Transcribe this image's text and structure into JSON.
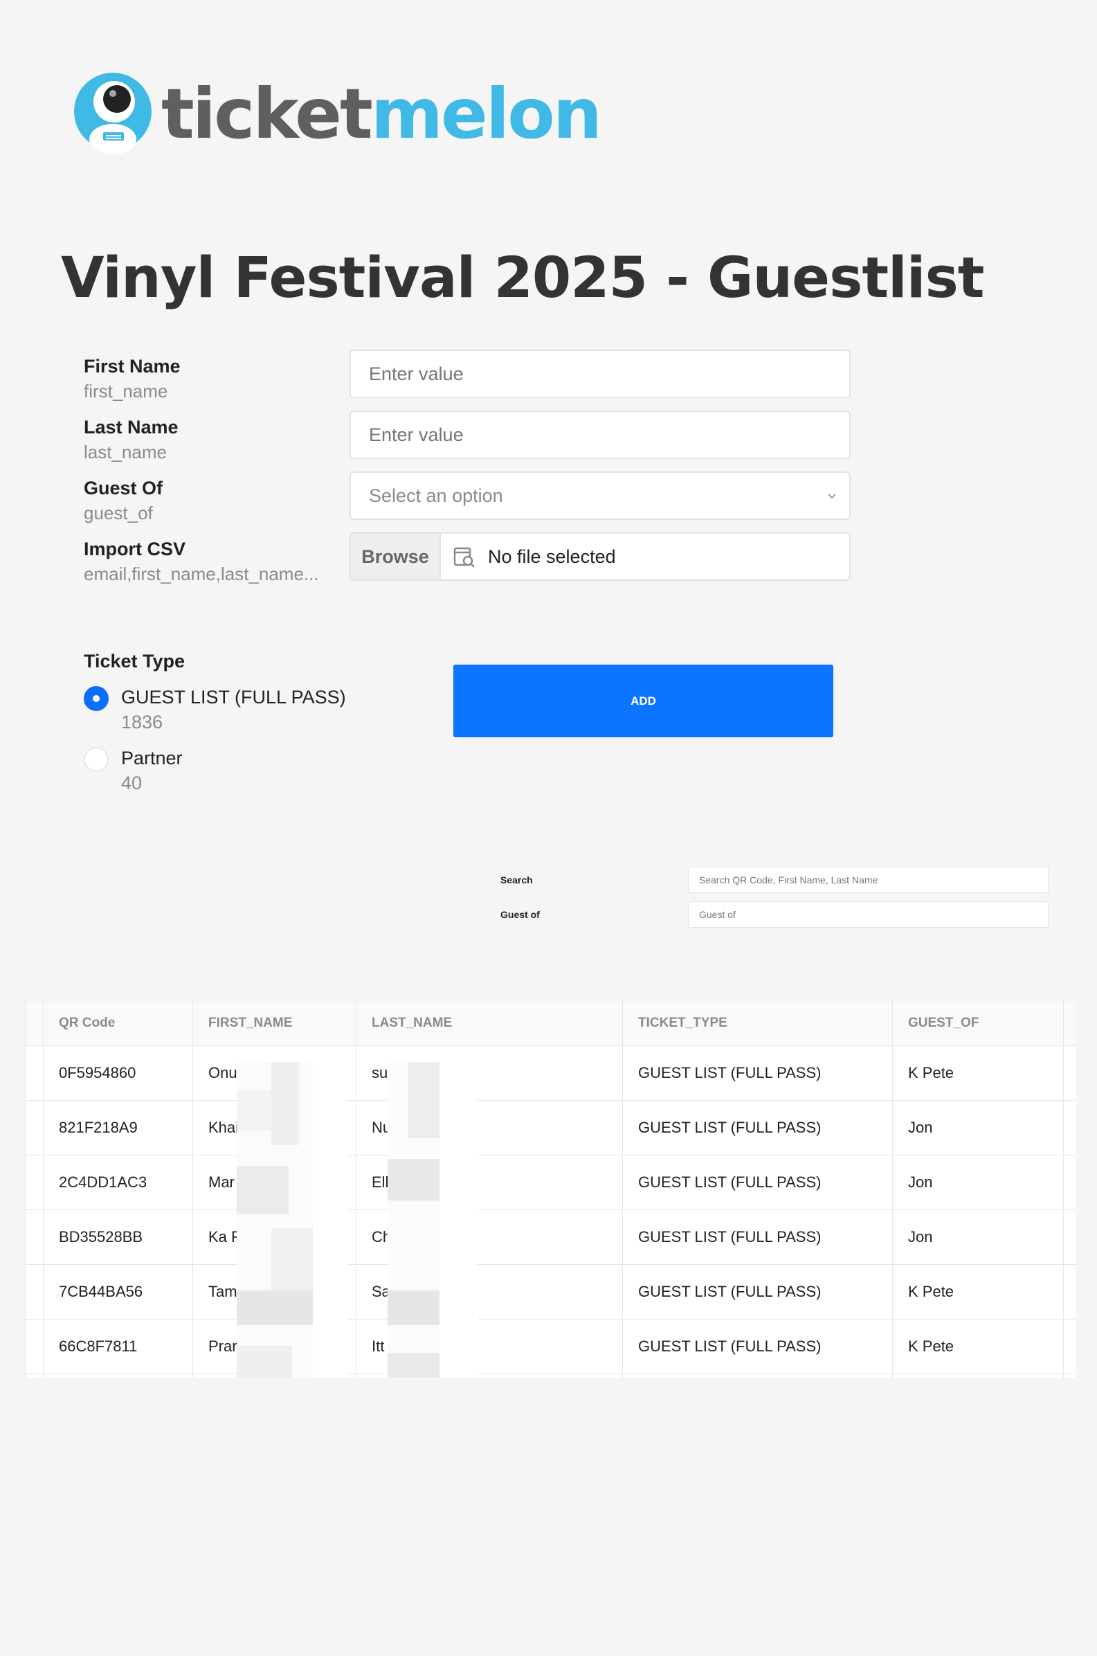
{
  "brand": {
    "logo_part1": "ticket",
    "logo_part2": "melon",
    "logo_colors": {
      "dark": "#5f5f5f",
      "accent": "#40b9e6"
    }
  },
  "page_title": "Vinyl Festival 2025 - Guestlist",
  "form": {
    "first_name": {
      "label": "First Name",
      "hint": "first_name",
      "placeholder": "Enter value"
    },
    "last_name": {
      "label": "Last Name",
      "hint": "last_name",
      "placeholder": "Enter value"
    },
    "guest_of": {
      "label": "Guest Of",
      "hint": "guest_of",
      "placeholder": "Select an option"
    },
    "import_csv": {
      "label": "Import CSV",
      "hint": "email,first_name,last_name...",
      "browse_label": "Browse",
      "file_status": "No file selected"
    }
  },
  "ticket_type": {
    "label": "Ticket Type",
    "options": [
      {
        "label": "GUEST LIST (FULL PASS)",
        "count": "1836",
        "selected": true
      },
      {
        "label": "Partner",
        "count": "40",
        "selected": false
      }
    ]
  },
  "add_button_label": "ADD",
  "accent_color": "#0d75ff",
  "filters": {
    "search": {
      "label": "Search",
      "placeholder": "Search QR Code, First Name, Last Name"
    },
    "guest_of": {
      "label": "Guest of",
      "placeholder": "Guest of"
    }
  },
  "table": {
    "headers": [
      "QR Code",
      "FIRST_NAME",
      "LAST_NAME",
      "TICKET_TYPE",
      "GUEST_OF"
    ],
    "rows": [
      {
        "qr": "0F5954860",
        "first": "Onu",
        "last": "su",
        "ticket": "GUEST LIST (FULL PASS)",
        "guest_of": "K Pete"
      },
      {
        "qr": "821F218A9",
        "first": "Khai",
        "last": "Nu",
        "ticket": "GUEST LIST (FULL PASS)",
        "guest_of": "Jon"
      },
      {
        "qr": "2C4DD1AC3",
        "first": "Mar",
        "last": "Ell",
        "ticket": "GUEST LIST (FULL PASS)",
        "guest_of": "Jon"
      },
      {
        "qr": "BD35528BB",
        "first": "Ka F",
        "last": "Ch",
        "ticket": "GUEST LIST (FULL PASS)",
        "guest_of": "Jon"
      },
      {
        "qr": "7CB44BA56",
        "first": "Tam",
        "last": "Sa",
        "ticket": "GUEST LIST (FULL PASS)",
        "guest_of": "K Pete"
      },
      {
        "qr": "66C8F7811",
        "first": "Prar",
        "last": "Itt",
        "ticket": "GUEST LIST (FULL PASS)",
        "guest_of": "K Pete"
      }
    ]
  }
}
